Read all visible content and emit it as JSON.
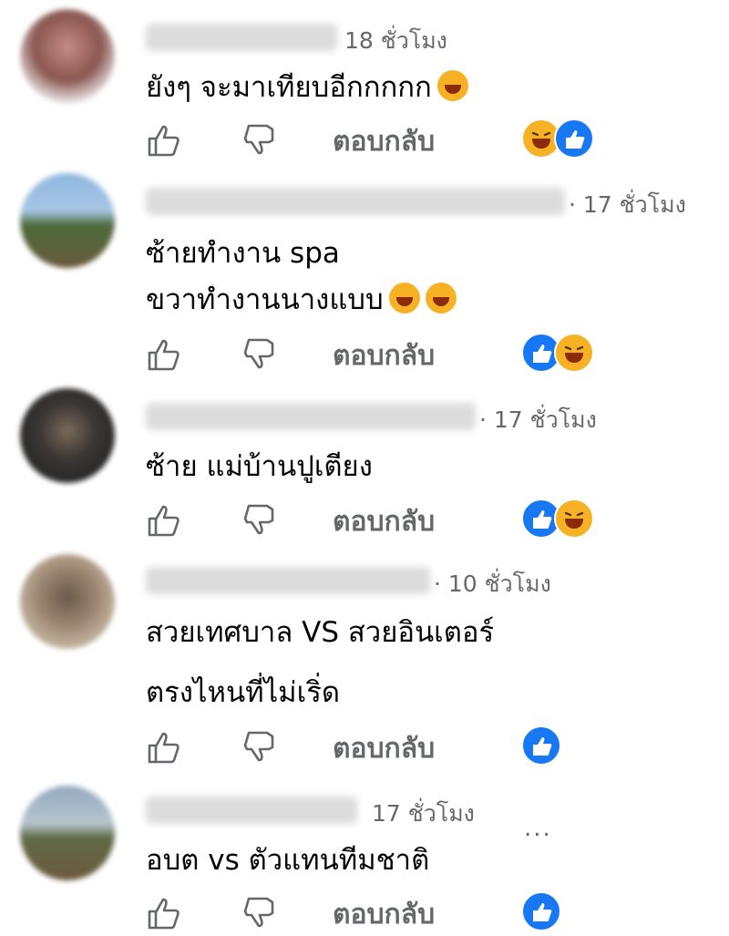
{
  "comments": [
    {
      "time": "18 ชั่วโมง",
      "lines": [
        "ยังๆ จะมาเทียบอีกกกกก"
      ],
      "reply_label": "ตอบกลับ",
      "reactions": [
        "haha-icon",
        "like-icon"
      ]
    },
    {
      "time": "· 17 ชั่วโมง",
      "lines": [
        "ซ้ายทำงาน spa",
        "ขวาทำงานนางแบบ"
      ],
      "reply_label": "ตอบกลับ",
      "reactions": [
        "like-icon",
        "haha-icon"
      ]
    },
    {
      "time": "· 17 ชั่วโมง",
      "lines": [
        "ซ้าย แม่บ้านปูเตียง"
      ],
      "reply_label": "ตอบกลับ",
      "reactions": [
        "like-icon",
        "haha-icon"
      ]
    },
    {
      "time": "· 10 ชั่วโมง",
      "lines": [
        "สวยเทศบาล VS สวยอินเตอร์",
        "ตรงไหนที่ไม่เริ่ด"
      ],
      "reply_label": "ตอบกลับ",
      "reactions": [
        "like-icon"
      ]
    },
    {
      "time": "17 ชั่วโมง",
      "lines": [
        "อบต vs ตัวแทนทีมชาติ"
      ],
      "reply_label": "ตอบกลับ",
      "more": "...",
      "reactions": [
        "like-icon"
      ]
    }
  ],
  "colors": {
    "like": "#1877f2",
    "haha": "#f7b125",
    "meta": "#65676b"
  }
}
